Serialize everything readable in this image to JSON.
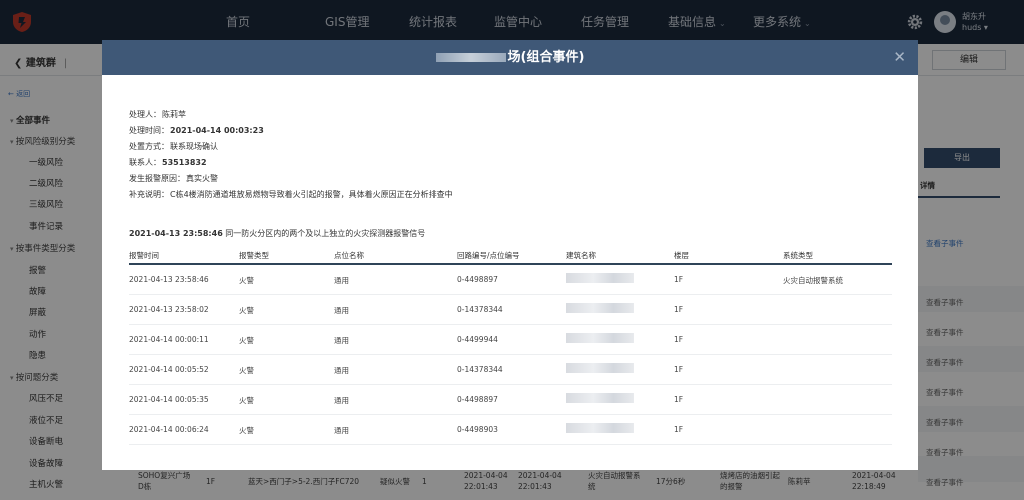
{
  "nav": {
    "items": [
      "首页",
      "GIS管理",
      "统计报表",
      "监管中心",
      "任务管理",
      "基础信息",
      "更多系统"
    ],
    "user_name": "胡东升",
    "user_sub": "huds ▾"
  },
  "page": {
    "back_title": "建筑群",
    "edit_label": "编辑",
    "side_back": "← 返回",
    "sidebar": [
      {
        "label": "全部事件",
        "kind": "bold"
      },
      {
        "label": "按风险级别分类",
        "kind": "grp"
      },
      {
        "label": "一级风险",
        "kind": "sub"
      },
      {
        "label": "二级风险",
        "kind": "sub"
      },
      {
        "label": "三级风险",
        "kind": "sub"
      },
      {
        "label": "事件记录",
        "kind": "sub"
      },
      {
        "label": "按事件类型分类",
        "kind": "grp"
      },
      {
        "label": "报警",
        "kind": "sub"
      },
      {
        "label": "故障",
        "kind": "sub"
      },
      {
        "label": "屏蔽",
        "kind": "sub"
      },
      {
        "label": "动作",
        "kind": "sub"
      },
      {
        "label": "隐患",
        "kind": "sub"
      },
      {
        "label": "按问题分类",
        "kind": "grp"
      },
      {
        "label": "风压不足",
        "kind": "sub"
      },
      {
        "label": "液位不足",
        "kind": "sub"
      },
      {
        "label": "设备断电",
        "kind": "sub"
      },
      {
        "label": "设备故障",
        "kind": "sub"
      },
      {
        "label": "主机火警",
        "kind": "sub"
      }
    ],
    "export_label": "导出",
    "detail_tab": "详情",
    "row_link": "查看子事件",
    "bottom_row": {
      "c1": "SOHO复兴广场D栋",
      "c2": "1F",
      "c3": "蓝天>西门子>5-2.西门子FC720",
      "c4": "疑似火警",
      "c5": "1",
      "c6": "2021-04-04 22:01:43",
      "c7": "2021-04-04 22:01:43",
      "c8": "火灾自动报警系统",
      "c9": "17分6秒",
      "c10": "烧烤店的油烟引起的报警",
      "c11": "陈莉苹",
      "c12": "2021-04-04 22:18:49"
    }
  },
  "modal": {
    "title_suffix": "场(组合事件)",
    "info": [
      {
        "label": "处理人：",
        "value": "陈莉苹",
        "bold": false
      },
      {
        "label": "处理时间：",
        "value": "2021-04-14 00:03:23",
        "bold": true
      },
      {
        "label": "处置方式：",
        "value": "联系现场确认",
        "bold": false
      },
      {
        "label": "联系人：",
        "value": "53513832",
        "bold": true
      },
      {
        "label": "发生报警原因：",
        "value": "真实火警",
        "bold": false
      },
      {
        "label": "补充说明：",
        "value": "C栋4楼消防通道堆放易燃物导致着火引起的报警，具体着火原因正在分析排查中",
        "bold": false
      }
    ],
    "event_time": "2021-04-13 23:58:46",
    "event_desc": " 同一防火分区内的两个及以上独立的火灾探测器报警信号",
    "columns": [
      "报警时间",
      "报警类型",
      "点位名称",
      "回路编号/点位编号",
      "建筑名称",
      "楼层",
      "系统类型"
    ],
    "rows": [
      {
        "time": "2021-04-13 23:58:46",
        "type": "火警",
        "point": "通用",
        "code": "0-4498897",
        "floor": "1F",
        "system": "火灾自动报警系统"
      },
      {
        "time": "2021-04-13 23:58:02",
        "type": "火警",
        "point": "通用",
        "code": "0-14378344",
        "floor": "1F",
        "system": ""
      },
      {
        "time": "2021-04-14 00:00:11",
        "type": "火警",
        "point": "通用",
        "code": "0-4499944",
        "floor": "1F",
        "system": ""
      },
      {
        "time": "2021-04-14 00:05:52",
        "type": "火警",
        "point": "通用",
        "code": "0-14378344",
        "floor": "1F",
        "system": ""
      },
      {
        "time": "2021-04-14 00:05:35",
        "type": "火警",
        "point": "通用",
        "code": "0-4498897",
        "floor": "1F",
        "system": ""
      },
      {
        "time": "2021-04-14 00:06:24",
        "type": "火警",
        "point": "通用",
        "code": "0-4498903",
        "floor": "1F",
        "system": ""
      }
    ]
  },
  "colors": {
    "topbar": "#1c2a3d",
    "modal_header": "#3f5877",
    "accent": "#344e6e",
    "logo": "#c0392b"
  }
}
